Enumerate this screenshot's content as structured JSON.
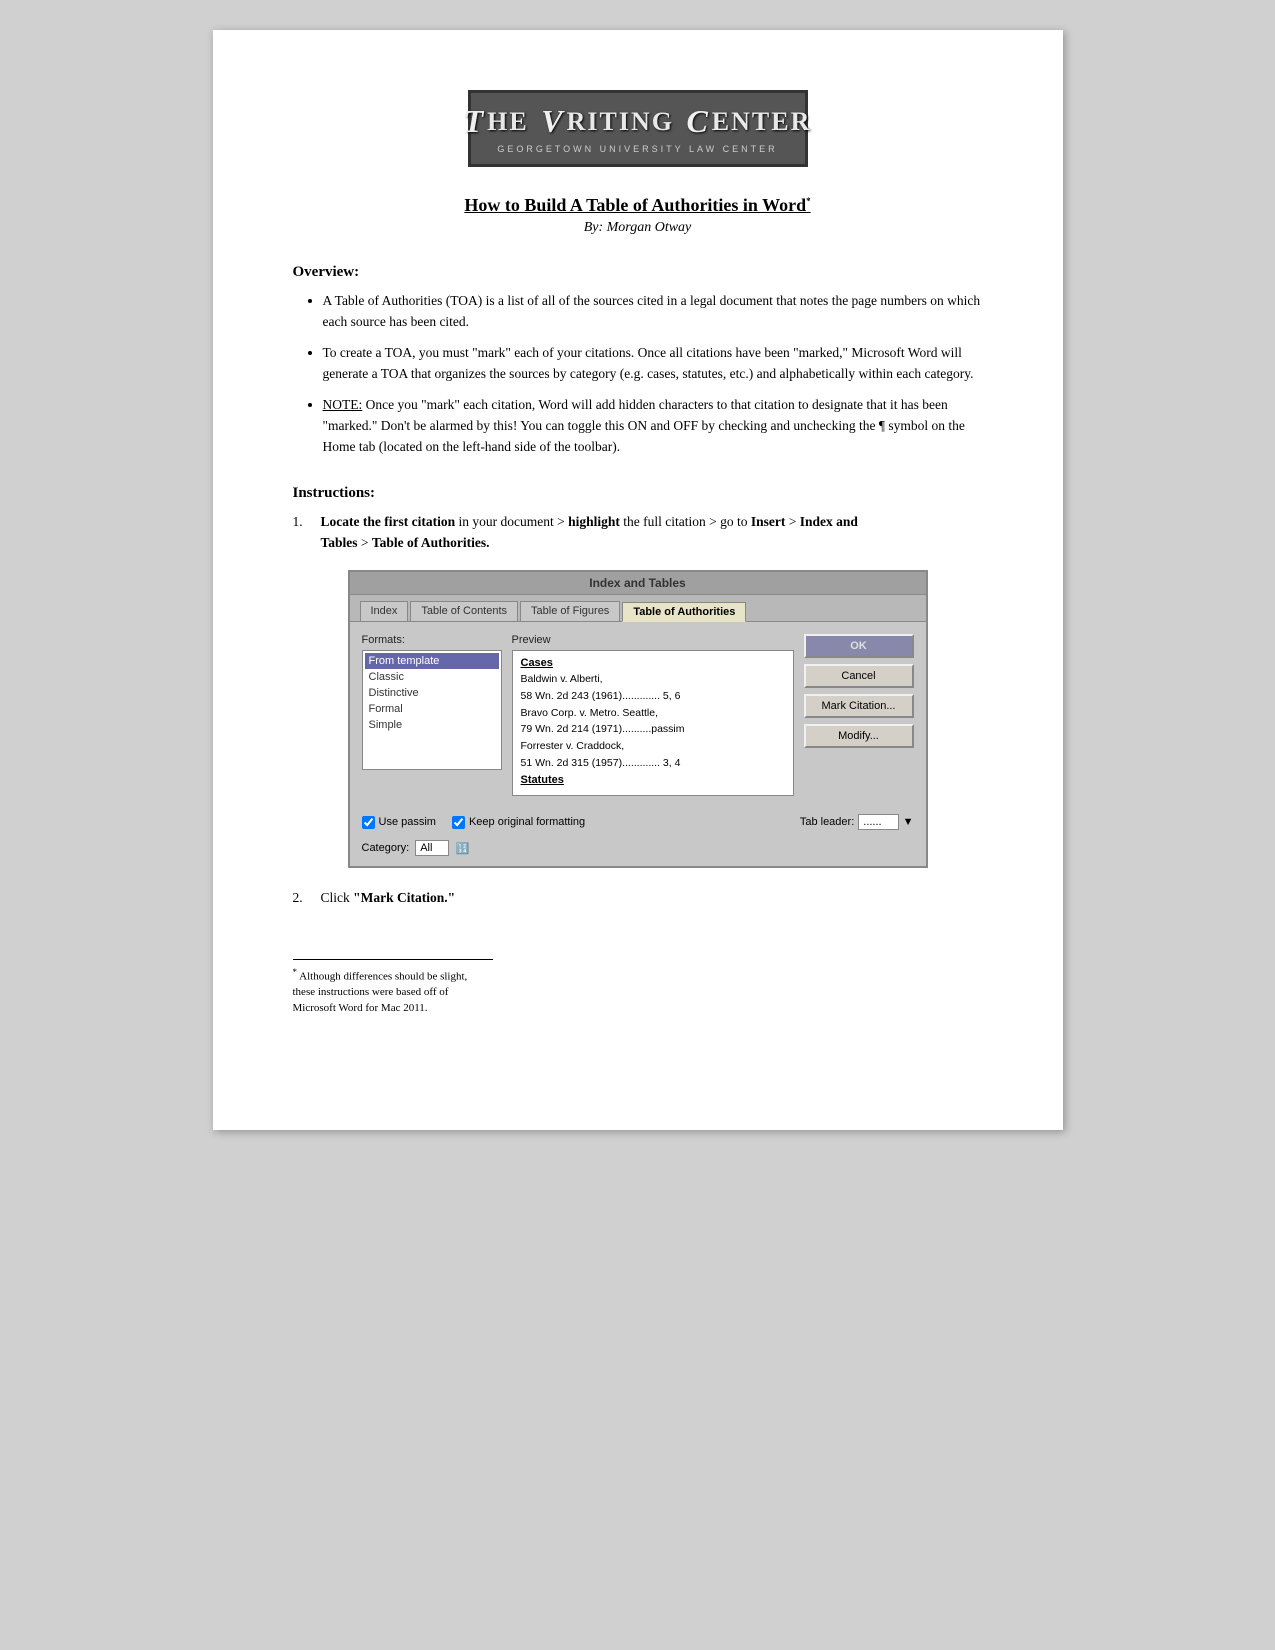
{
  "logo": {
    "title_prefix": "HE",
    "title_v": "V",
    "title_rest": "RITING",
    "title_c": "C",
    "title_end": "ENTER",
    "subtitle": "GEORGETOWN UNIVERSITY LAW CENTER"
  },
  "doc_title": "How to Build A Table of Authorities in Word",
  "doc_title_sup": "*",
  "author": "By: Morgan Otway",
  "overview_heading": "Overview:",
  "bullets": [
    "A Table of Authorities (TOA) is a list of all of the sources cited in a legal document that notes the page numbers on which each source has been cited.",
    "To create a TOA, you must \"mark\" each of your citations. Once all citations have been \"marked,\" Microsoft Word will generate a TOA that organizes the sources by category (e.g. cases, statutes, etc.) and alphabetically within each category.",
    "NOTE: Once you \"mark\" each citation, Word will add hidden characters to that citation to designate that it has been \"marked.\" Don't be alarmed by this! You can toggle this ON and OFF by checking and unchecking the ¶ symbol on the Home tab (located on the left-hand side of the toolbar)."
  ],
  "instructions_heading": "Instructions:",
  "instructions": [
    {
      "number": "1.",
      "text_parts": [
        {
          "label": "Locate the first citation",
          "bold": true
        },
        " in your document > ",
        {
          "label": "highlight",
          "bold": true
        },
        " the full citation > go to ",
        {
          "label": "Insert",
          "bold": true
        },
        " > ",
        {
          "label": "Index and",
          "bold": true
        },
        " ",
        {
          "label": "Tables",
          "bold": true
        },
        " > ",
        {
          "label": "Table of Authorities.",
          "bold": true
        }
      ]
    },
    {
      "number": "2.",
      "text_parts": [
        "Click ",
        {
          "label": "\"Mark Citation.\"",
          "bold": true
        }
      ]
    }
  ],
  "dialog": {
    "title": "Index and Tables",
    "tabs": [
      "Index",
      "Table of Contents",
      "Table of Figures",
      "Table of Authorities"
    ],
    "active_tab": "Table of Authorities",
    "formats_label": "Formats:",
    "formats": [
      {
        "label": "From template",
        "selected": true
      },
      {
        "label": "Classic",
        "selected": false
      },
      {
        "label": "Distinctive",
        "selected": false
      },
      {
        "label": "Formal",
        "selected": false
      },
      {
        "label": "Simple",
        "selected": false
      }
    ],
    "preview_label": "Preview",
    "preview_cases_heading": "Cases",
    "preview_cases": [
      "Baldwin v. Alberti,",
      "    58 Wn. 2d 243 (1961)............. 5, 6",
      "Bravo Corp. v. Metro. Seattle,",
      "    79 Wn. 2d 214 (1971)..........passim",
      "Forrester v. Craddock,",
      "    51 Wn. 2d 315 (1957)............. 3, 4"
    ],
    "preview_statutes_heading": "Statutes",
    "buttons": [
      "OK",
      "Cancel",
      "Mark Citation...",
      "Modify..."
    ],
    "use_passim_label": "Use passim",
    "keep_formatting_label": "Keep original formatting",
    "category_label": "Category:",
    "category_value": "All",
    "tab_leader_label": "Tab leader:",
    "tab_leader_value": "......"
  },
  "footnote_marker": "*",
  "footnote_text": "Although differences should be slight, these instructions were based off of Microsoft Word for Mac 2011."
}
